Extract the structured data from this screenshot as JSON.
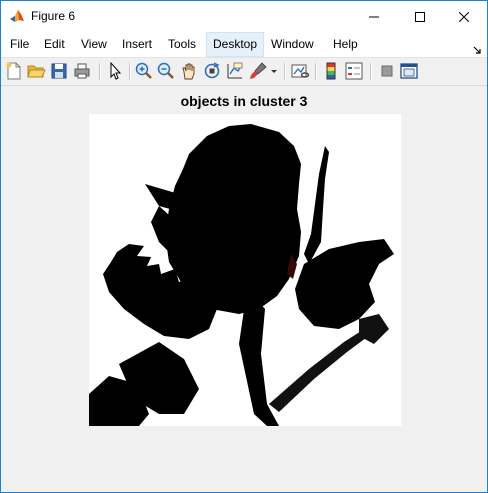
{
  "window": {
    "title": "Figure 6"
  },
  "menu": {
    "items": [
      {
        "label": "File",
        "name": "menu-file"
      },
      {
        "label": "Edit",
        "name": "menu-edit"
      },
      {
        "label": "View",
        "name": "menu-view"
      },
      {
        "label": "Insert",
        "name": "menu-insert"
      },
      {
        "label": "Tools",
        "name": "menu-tools"
      },
      {
        "label": "Desktop",
        "name": "menu-desktop"
      },
      {
        "label": "Window",
        "name": "menu-window"
      },
      {
        "label": "Help",
        "name": "menu-help"
      }
    ],
    "active": "Desktop"
  },
  "toolbar": {
    "icons": [
      "new-figure-icon",
      "open-file-icon",
      "save-icon",
      "print-icon",
      "pointer-icon",
      "zoom-in-icon",
      "zoom-out-icon",
      "pan-icon",
      "rotate-3d-icon",
      "data-cursor-icon",
      "brush-icon",
      "link-plot-icon",
      "colorbar-icon",
      "legend-icon",
      "hide-plot-tools-icon",
      "show-plot-tools-icon"
    ]
  },
  "figure": {
    "axes_title": "objects in cluster 3"
  },
  "colors": {
    "accent": "#1883d7",
    "menu_bg": "#ffffff",
    "figure_bg": "#f0f0f0"
  }
}
